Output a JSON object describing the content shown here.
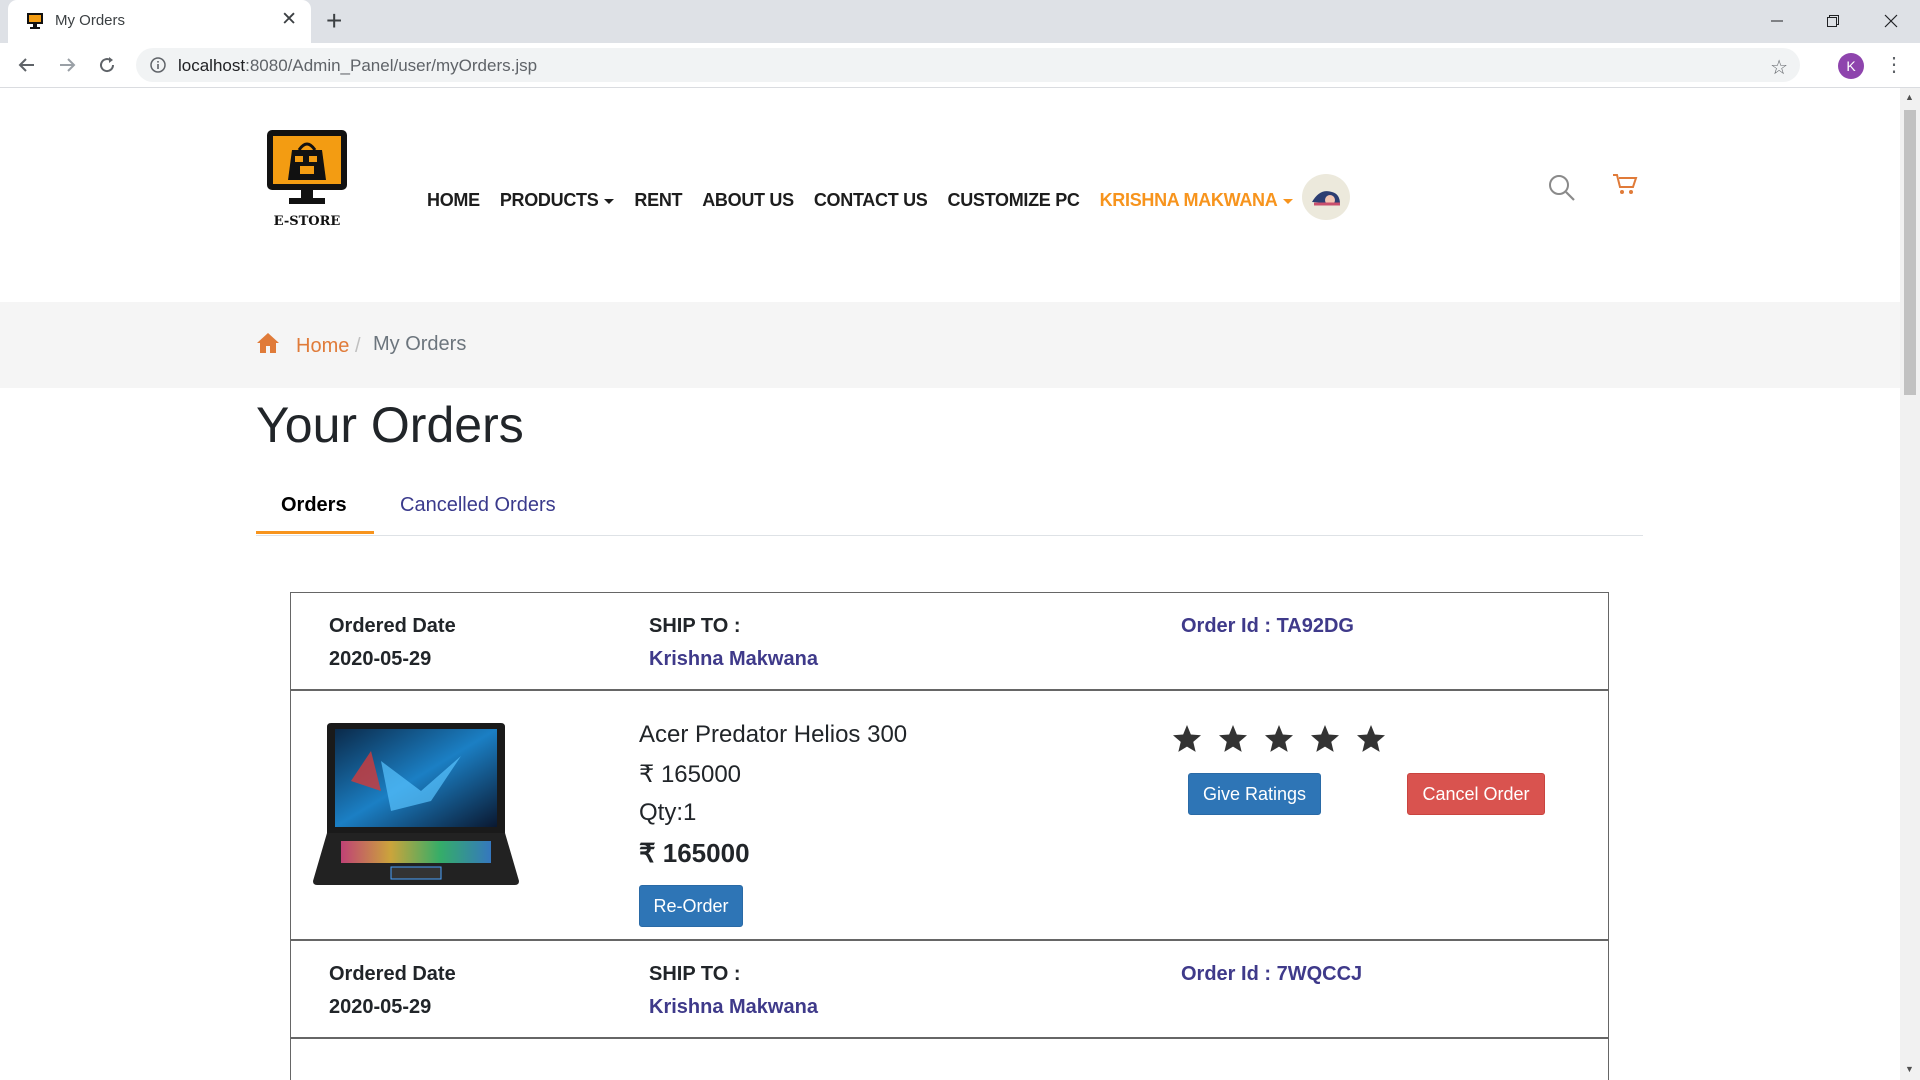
{
  "browser": {
    "tab_title": "My Orders",
    "new_tab_symbol": "+",
    "url_host": "localhost",
    "url_rest": ":8080/Admin_Panel/user/myOrders.jsp",
    "profile_initial": "K"
  },
  "site": {
    "logo_text": "E-STORE",
    "nav": {
      "home": "HOME",
      "products": "PRODUCTS",
      "rent": "RENT",
      "about": "ABOUT US",
      "contact": "CONTACT US",
      "customize": "CUSTOMIZE PC",
      "user": "KRISHNA MAKWANA"
    },
    "accent_color": "#f7941d"
  },
  "breadcrumb": {
    "home": "Home",
    "separator": "/",
    "current": "My Orders"
  },
  "page": {
    "title": "Your Orders",
    "tabs": {
      "orders": "Orders",
      "cancelled": "Cancelled Orders"
    }
  },
  "orders": [
    {
      "ordered_date_label": "Ordered Date",
      "ordered_date": "2020-05-29",
      "ship_to_label": "SHIP TO :",
      "ship_to_name": "Krishna Makwana",
      "order_id": "Order Id : TA92DG",
      "item": {
        "name": "Acer Predator Helios 300",
        "price": "₹ 165000",
        "qty": "Qty:1",
        "total": "₹ 165000",
        "reorder_label": "Re-Order",
        "rating_stars": 5,
        "give_ratings_label": "Give Ratings",
        "cancel_label": "Cancel Order"
      }
    },
    {
      "ordered_date_label": "Ordered Date",
      "ordered_date": "2020-05-29",
      "ship_to_label": "SHIP TO :",
      "ship_to_name": "Krishna Makwana",
      "order_id": "Order Id : 7WQCCJ"
    }
  ]
}
